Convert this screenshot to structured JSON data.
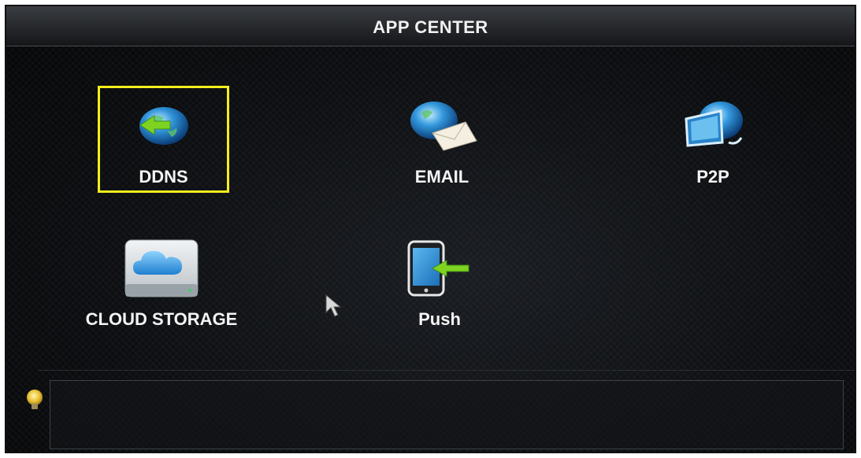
{
  "window": {
    "title": "APP CENTER"
  },
  "apps": [
    {
      "label": "DDNS",
      "icon": "globe-arrow-icon"
    },
    {
      "label": "EMAIL",
      "icon": "globe-envelope-icon"
    },
    {
      "label": "P2P",
      "icon": "globe-monitor-icon"
    },
    {
      "label": "CLOUD STORAGE",
      "icon": "cloud-storage-icon"
    },
    {
      "label": "Push",
      "icon": "phone-arrow-icon"
    }
  ],
  "selected_app": "DDNS",
  "tip": {
    "icon": "lightbulb-icon",
    "text": ""
  },
  "colors": {
    "highlight": "#f4ee1c",
    "label_text": "#f4f4f4",
    "background": "#0c0e11"
  }
}
